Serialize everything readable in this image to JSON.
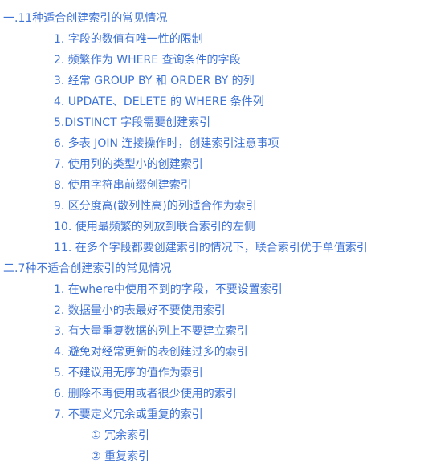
{
  "sections": [
    {
      "title": "一.11种适合创建索引的常见情况",
      "items": [
        "1. 字段的数值有唯一性的限制",
        "2. 频繁作为 WHERE 查询条件的字段",
        "3. 经常 GROUP BY 和 ORDER BY 的列",
        "4. UPDATE、DELETE 的 WHERE 条件列",
        "5.DISTINCT 字段需要创建索引",
        "6. 多表 JOIN 连接操作时，创建索引注意事项",
        "7. 使用列的类型小的创建索引",
        "8. 使用字符串前缀创建索引",
        "9. 区分度高(散列性高)的列适合作为索引",
        "10. 使用最频繁的列放到联合索引的左侧",
        "11. 在多个字段都要创建索引的情况下，联合索引优于单值索引"
      ]
    },
    {
      "title": "二.7种不适合创建索引的常见情况",
      "items": [
        "1. 在where中使用不到的字段，不要设置索引",
        "2. 数据量小的表最好不要使用索引",
        "3. 有大量重复数据的列上不要建立索引",
        "4. 避免对经常更新的表创建过多的索引",
        "5. 不建议用无序的值作为索引",
        "6. 删除不再使用或者很少使用的索引",
        "7. 不要定义冗余或重复的索引"
      ],
      "subitems": [
        "① 冗余索引",
        "② 重复索引"
      ]
    }
  ]
}
